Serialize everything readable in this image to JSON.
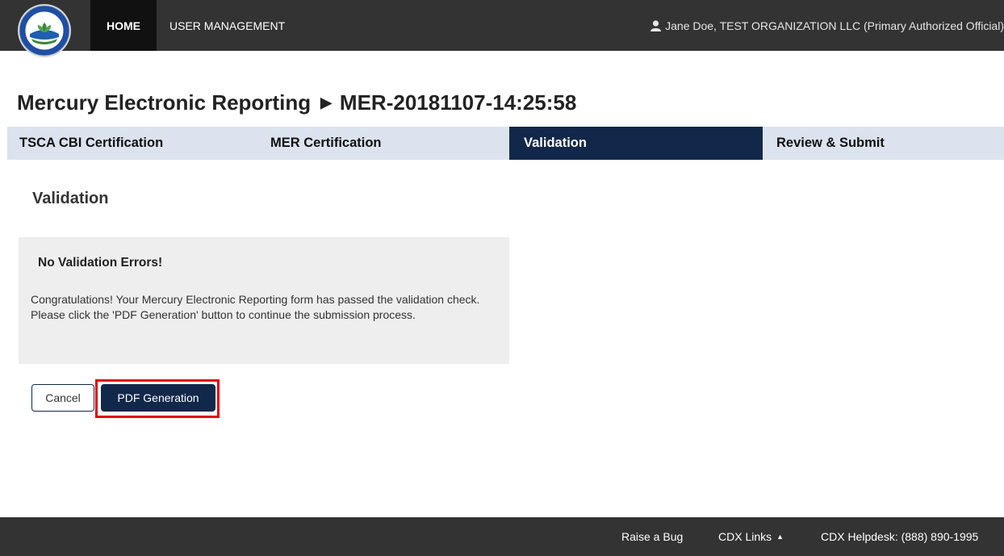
{
  "header": {
    "logo_alt": "United States Environmental Protection Agency",
    "nav": {
      "home": "HOME",
      "user_management": "USER MANAGEMENT"
    },
    "user": "Jane Doe, TEST ORGANIZATION LLC (Primary Authorized Official)"
  },
  "page": {
    "title": "Mercury Electronic Reporting",
    "separator": "▶",
    "record_id": "MER-20181107-14:25:58"
  },
  "tabs": [
    {
      "label": "TSCA CBI Certification",
      "active": false
    },
    {
      "label": "MER Certification",
      "active": false
    },
    {
      "label": "Validation",
      "active": true
    },
    {
      "label": "Review & Submit",
      "active": false
    }
  ],
  "section": {
    "title": "Validation",
    "alert_title": "No Validation Errors!",
    "alert_line1": "Congratulations! Your Mercury Electronic Reporting form has passed the validation check.",
    "alert_line2": "Please click the 'PDF Generation' button to continue the submission process."
  },
  "buttons": {
    "cancel": "Cancel",
    "pdf_generation": "PDF Generation"
  },
  "footer": {
    "raise_bug": "Raise a Bug",
    "cdx_links": "CDX Links",
    "cdx_links_caret": "▲",
    "helpdesk": "CDX Helpdesk: (888) 890-1995"
  },
  "colors": {
    "nav_bg": "#333333",
    "tab_bar_bg": "#dbe3ee",
    "active_tab_bg": "#12284a",
    "primary_button": "#12284a",
    "highlight": "#e3000f"
  }
}
